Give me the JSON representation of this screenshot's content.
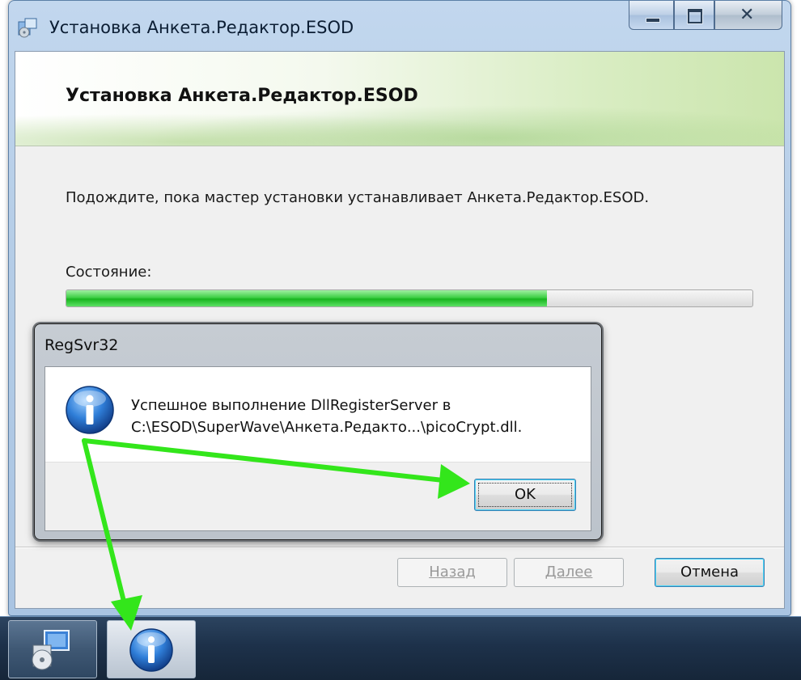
{
  "window": {
    "title": "Установка Анкета.Редактор.ESOD",
    "icons": {
      "app": "installer-icon",
      "minimize": "minimize-icon",
      "maximize": "maximize-icon",
      "close": "close-icon"
    }
  },
  "wizard": {
    "banner_title": "Установка Анкета.Редактор.ESOD",
    "message": "Подождите, пока мастер установки устанавливает Анкета.Редактор.ESOD.",
    "status_label": "Состояние:",
    "progress": 0.7
  },
  "buttons": {
    "back": "Назад",
    "next": "Далее",
    "cancel": "Отмена"
  },
  "dialog": {
    "title": "RegSvr32",
    "line1": "Успешное выполнение DllRegisterServer в",
    "line2": "C:\\ESOD\\SuperWave\\Анкета.Редакто...\\picoCrypt.dll.",
    "ok": "OK",
    "icon": "info-icon"
  },
  "taskbar": {
    "items": [
      "installer-icon",
      "info-icon"
    ]
  },
  "colors": {
    "arrow": "#33e61b",
    "progress": "#27c12f",
    "taskbar": "#1d314a"
  }
}
